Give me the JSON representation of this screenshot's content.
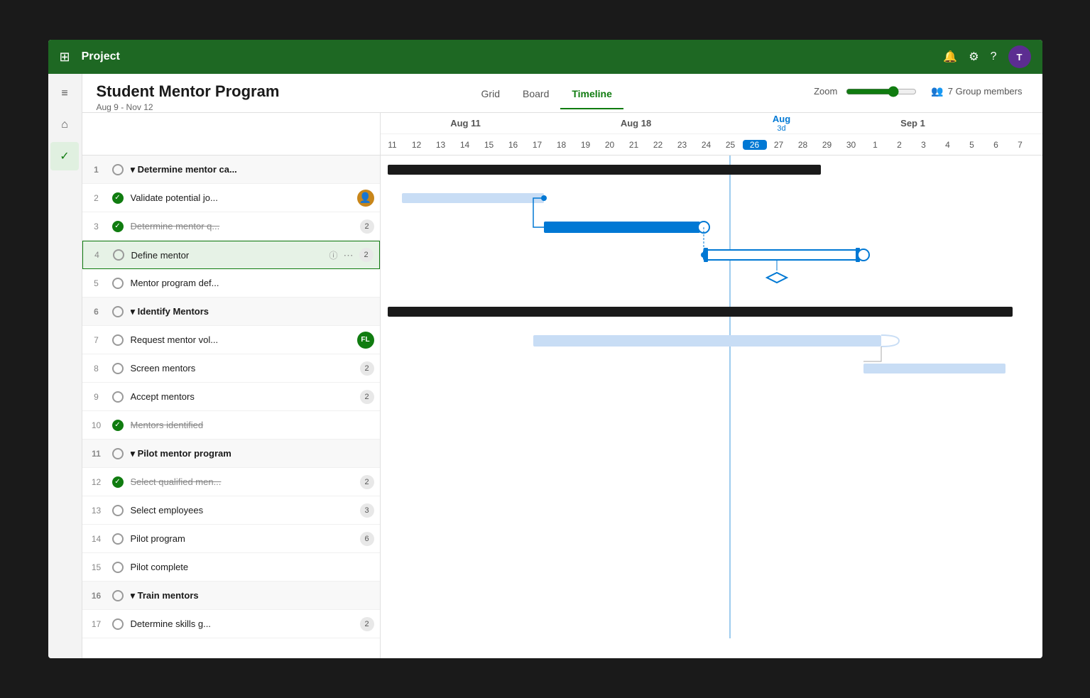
{
  "app": {
    "name": "Project",
    "avatar_initials": "T"
  },
  "topbar": {
    "title": "Project",
    "icons": [
      "grid",
      "bell",
      "settings",
      "help"
    ]
  },
  "project": {
    "title": "Student Mentor Program",
    "dates": "Aug 9 - Nov 12",
    "nav_tabs": [
      "Grid",
      "Board",
      "Timeline"
    ],
    "active_tab": "Timeline",
    "zoom_label": "Zoom",
    "group_members": "7 Group members"
  },
  "timeline": {
    "weeks": [
      {
        "label": "Aug 11",
        "days": []
      },
      {
        "label": "Aug 18",
        "days": []
      },
      {
        "label": "Aug",
        "days": [
          "22",
          "23",
          "24",
          "25",
          "26"
        ]
      },
      {
        "label": "Sep 1",
        "days": []
      }
    ],
    "today_col": "26",
    "today_month_label": "Aug",
    "3d_label": "3d"
  },
  "tasks": [
    {
      "num": 1,
      "status": "circle",
      "name": "Determine mentor ca...",
      "badge": null,
      "avatar": null,
      "section": true,
      "expanded": true,
      "strikethrough": false
    },
    {
      "num": 2,
      "status": "check",
      "name": "Validate potential jo...",
      "badge": null,
      "avatar": "person",
      "section": false,
      "strikethrough": false
    },
    {
      "num": 3,
      "status": "check",
      "name": "Determine mentor q...",
      "badge": "2",
      "avatar": null,
      "section": false,
      "strikethrough": true
    },
    {
      "num": 4,
      "status": "circle",
      "name": "Define mentor",
      "badge": "2",
      "avatar": null,
      "section": false,
      "strikethrough": false,
      "selected": true,
      "info": true,
      "more": true
    },
    {
      "num": 5,
      "status": "circle",
      "name": "Mentor program def...",
      "badge": null,
      "avatar": null,
      "section": false,
      "strikethrough": false
    },
    {
      "num": 6,
      "status": "circle",
      "name": "Identify Mentors",
      "badge": null,
      "avatar": null,
      "section": true,
      "expanded": true,
      "strikethrough": false
    },
    {
      "num": 7,
      "status": "circle",
      "name": "Request mentor vol...",
      "badge": null,
      "avatar": "FL",
      "section": false,
      "strikethrough": false
    },
    {
      "num": 8,
      "status": "circle",
      "name": "Screen mentors",
      "badge": "2",
      "avatar": null,
      "section": false,
      "strikethrough": false
    },
    {
      "num": 9,
      "status": "circle",
      "name": "Accept mentors",
      "badge": "2",
      "avatar": null,
      "section": false,
      "strikethrough": false
    },
    {
      "num": 10,
      "status": "check",
      "name": "Mentors identified",
      "badge": null,
      "avatar": null,
      "section": false,
      "strikethrough": true
    },
    {
      "num": 11,
      "status": "circle",
      "name": "Pilot mentor program",
      "badge": null,
      "avatar": null,
      "section": true,
      "expanded": true,
      "strikethrough": false
    },
    {
      "num": 12,
      "status": "check",
      "name": "Select qualified men...",
      "badge": "2",
      "avatar": null,
      "section": false,
      "strikethrough": true
    },
    {
      "num": 13,
      "status": "circle",
      "name": "Select employees",
      "badge": "3",
      "avatar": null,
      "section": false,
      "strikethrough": false
    },
    {
      "num": 14,
      "status": "circle",
      "name": "Pilot program",
      "badge": "6",
      "avatar": null,
      "section": false,
      "strikethrough": false
    },
    {
      "num": 15,
      "status": "circle",
      "name": "Pilot complete",
      "badge": null,
      "avatar": null,
      "section": false,
      "strikethrough": false
    },
    {
      "num": 16,
      "status": "circle",
      "name": "Train mentors",
      "badge": null,
      "avatar": null,
      "section": true,
      "expanded": true,
      "strikethrough": false
    },
    {
      "num": 17,
      "status": "circle",
      "name": "Determine skills g...",
      "badge": "2",
      "avatar": null,
      "section": false,
      "strikethrough": false
    }
  ],
  "sidebar_icons": [
    {
      "name": "hamburger",
      "symbol": "≡",
      "active": false
    },
    {
      "name": "home",
      "symbol": "⌂",
      "active": false
    },
    {
      "name": "checkmark",
      "symbol": "✓",
      "active": true
    }
  ]
}
